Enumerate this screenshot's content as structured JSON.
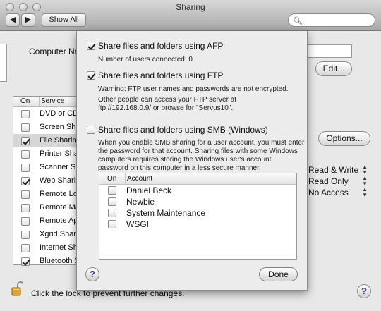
{
  "window": {
    "title": "Sharing"
  },
  "toolbar": {
    "show_all": "Show All"
  },
  "background": {
    "computer_name_label": "Computer Na",
    "edit_button": "Edit...",
    "options_button": "Options...",
    "table_headers": {
      "on": "On",
      "service": "Service"
    },
    "services": [
      {
        "label": "DVD or CD",
        "on": false,
        "selected": false
      },
      {
        "label": "Screen Sha",
        "on": false,
        "selected": false
      },
      {
        "label": "File Sharing",
        "on": true,
        "selected": true
      },
      {
        "label": "Printer Sha",
        "on": false,
        "selected": false
      },
      {
        "label": "Scanner Sh",
        "on": false,
        "selected": false
      },
      {
        "label": "Web Sharin",
        "on": true,
        "selected": false
      },
      {
        "label": "Remote Log",
        "on": false,
        "selected": false
      },
      {
        "label": "Remote Ma",
        "on": false,
        "selected": false
      },
      {
        "label": "Remote Ap",
        "on": false,
        "selected": false
      },
      {
        "label": "Xgrid Shari",
        "on": false,
        "selected": false
      },
      {
        "label": "Internet Sh",
        "on": false,
        "selected": false
      },
      {
        "label": "Bluetooth S",
        "on": true,
        "selected": false
      }
    ],
    "permissions": [
      "Read & Write",
      "Read Only",
      "No Access"
    ],
    "lock_text": "Click the lock to prevent further changes."
  },
  "sheet": {
    "afp": {
      "label": "Share files and folders using AFP",
      "checked": true,
      "users_connected": "Number of users connected: 0"
    },
    "ftp": {
      "label": "Share files and folders using FTP",
      "checked": true,
      "warning": "Warning: FTP user names and passwords are not encrypted.",
      "info_line1": "Other people can access your FTP server at",
      "info_line2": "ftp://192.168.0.9/ or browse for \"Servus10\"."
    },
    "smb": {
      "label": "Share files and folders using SMB (Windows)",
      "checked": false,
      "desc": [
        "When you enable SMB sharing for a user account, you must enter",
        "the password for that account. Sharing files with some Windows",
        "computers requires storing the Windows user's account",
        "password on this computer in a less secure manner."
      ]
    },
    "accounts_headers": {
      "on": "On",
      "account": "Account"
    },
    "accounts": [
      {
        "name": "Daniel Beck",
        "on": false
      },
      {
        "name": "Newbie",
        "on": false
      },
      {
        "name": "System Maintenance",
        "on": false
      },
      {
        "name": "WSGI",
        "on": false
      }
    ],
    "done_button": "Done"
  },
  "icons": {
    "lock": "lock-open-icon",
    "help": "help-icon",
    "search": "search-icon"
  }
}
